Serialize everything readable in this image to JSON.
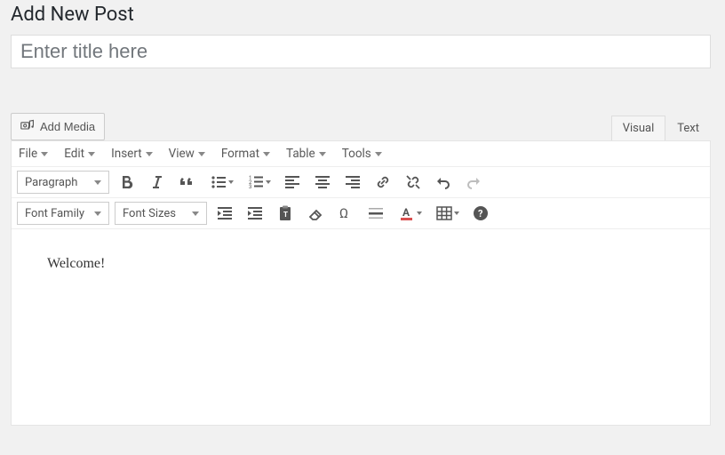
{
  "page_title": "Add New Post",
  "title_placeholder": "Enter title here",
  "title_value": "",
  "add_media_label": "Add Media",
  "tabs": {
    "visual": "Visual",
    "text": "Text",
    "active": "visual"
  },
  "menubar": {
    "file": "File",
    "edit": "Edit",
    "insert": "Insert",
    "view": "View",
    "format": "Format",
    "table": "Table",
    "tools": "Tools"
  },
  "dropdowns": {
    "paragraph": "Paragraph",
    "font_family": "Font Family",
    "font_sizes": "Font Sizes"
  },
  "content_text": "Welcome!"
}
